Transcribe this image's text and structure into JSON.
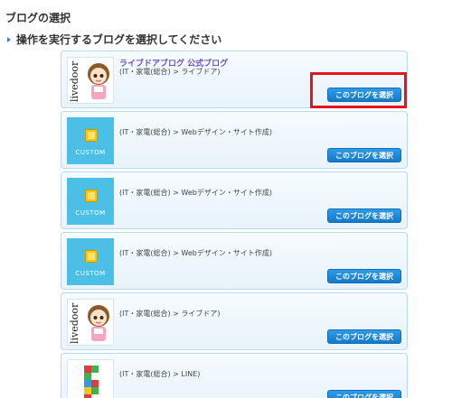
{
  "page_title": "ブログの選択",
  "section_heading": "操作を実行するブログを選択してください",
  "select_label": "このブログを選択",
  "custom_label": "CUSTOM",
  "livedoor_label": "livedoor",
  "blogs": [
    {
      "title": "ライブドアブログ 公式ブログ",
      "category": "(IT・家電(総合) > ライブドア)",
      "thumb": "livedoor",
      "blurred": false
    },
    {
      "title": "",
      "category": "(IT・家電(総合) > Webデザイン・サイト作成)",
      "thumb": "custom",
      "blurred": true
    },
    {
      "title": "",
      "category": "(IT・家電(総合) > Webデザイン・サイト作成)",
      "thumb": "custom",
      "blurred": true
    },
    {
      "title": "",
      "category": "(IT・家電(総合) > Webデザイン・サイト作成)",
      "thumb": "custom",
      "blurred": true
    },
    {
      "title": "",
      "category": "(IT・家電(総合) > ライブドア)",
      "thumb": "livedoor",
      "blurred": true
    },
    {
      "title": "",
      "category": "(IT・家電(総合) > LINE)",
      "thumb": "line",
      "blurred": true
    }
  ],
  "colors": {
    "accent": "#1479c9",
    "highlight": "#e8141b",
    "card_border": "#b9d9ee",
    "title": "#6b4cc8"
  }
}
